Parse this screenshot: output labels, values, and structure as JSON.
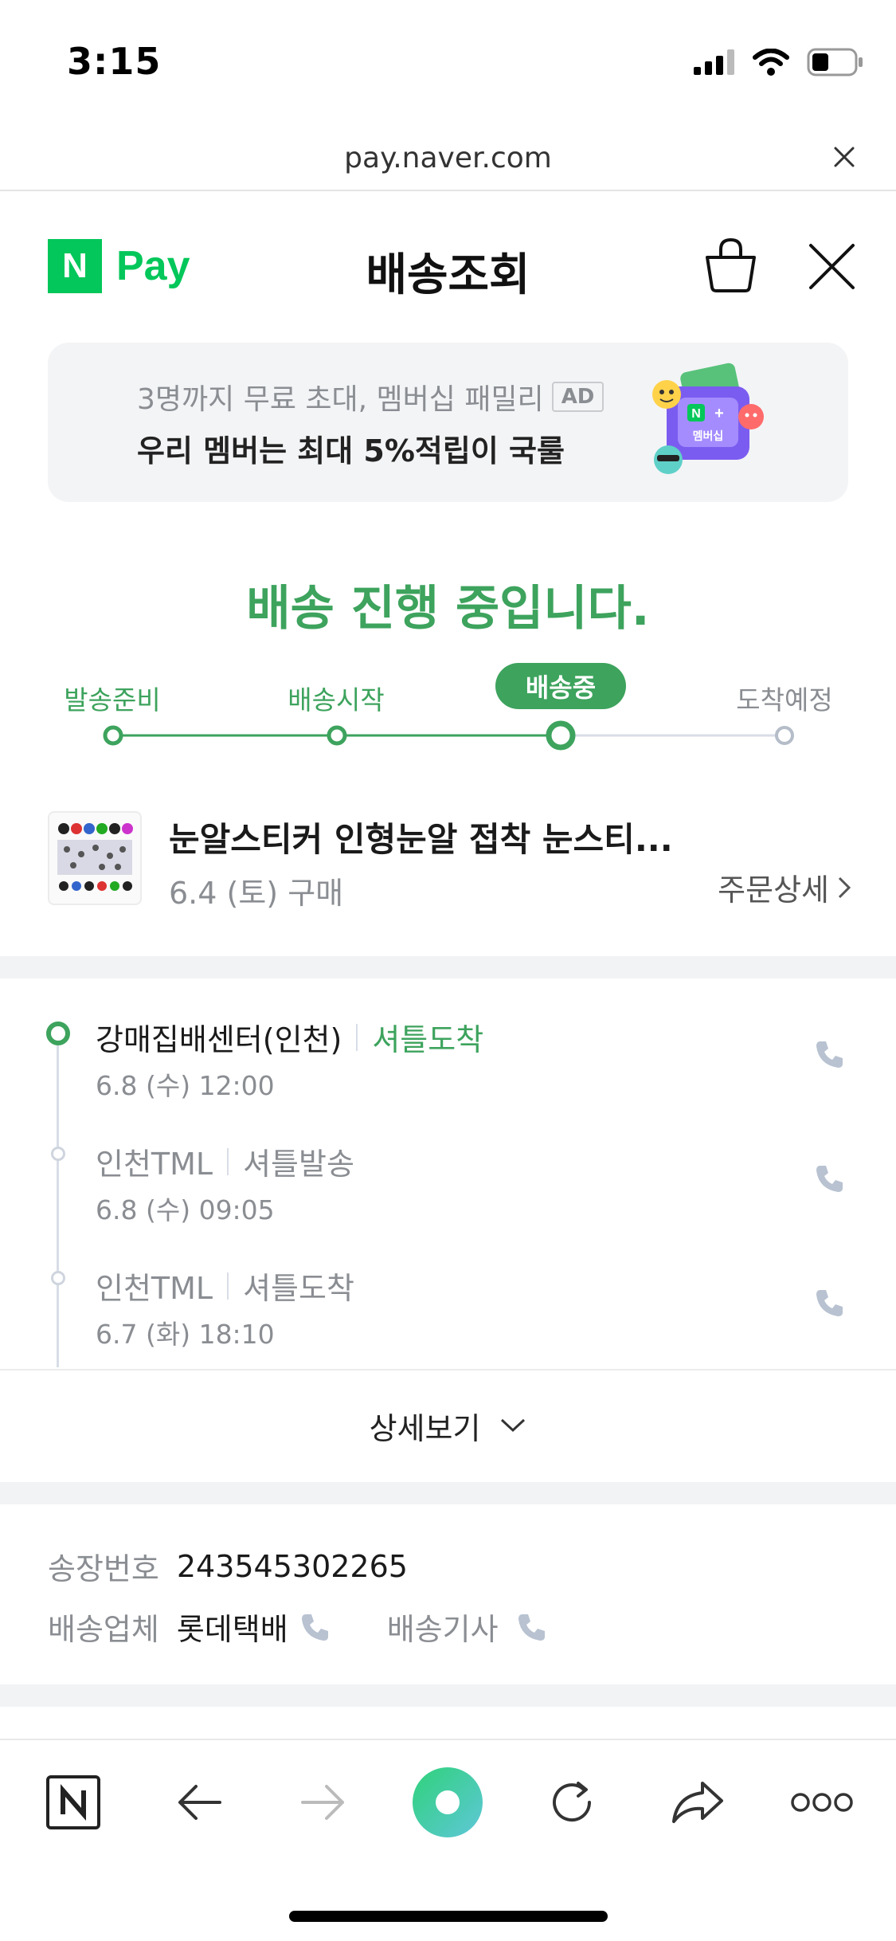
{
  "status_bar": {
    "time": "3:15"
  },
  "browser": {
    "url": "pay.naver.com"
  },
  "header": {
    "logo_n": "N",
    "logo_text": "Pay",
    "title": "배송조회"
  },
  "ad": {
    "line1": "3명까지 무료 초대, 멤버십 패밀리",
    "badge": "AD",
    "line2": "우리 멤버는 최대 5%적립이 국룰",
    "art_text": "멤버십"
  },
  "delivery": {
    "status_message": "배송 진행 중입니다.",
    "steps": [
      "발송준비",
      "배송시작",
      "배송중",
      "도착예정"
    ],
    "current_step": 3
  },
  "product": {
    "name": "눈알스티커 인형눈알 접착 눈스티...",
    "purchase_date": "6.4 (토) 구매",
    "order_detail_label": "주문상세"
  },
  "timeline": [
    {
      "place": "강매집배센터(인천)",
      "status": "셔틀도착",
      "time": "6.8 (수) 12:00"
    },
    {
      "place": "인천TML",
      "status": "셔틀발송",
      "time": "6.8 (수) 09:05"
    },
    {
      "place": "인천TML",
      "status": "셔틀도착",
      "time": "6.7 (화) 18:10"
    }
  ],
  "more_label": "상세보기",
  "invoice": {
    "number_label": "송장번호",
    "number": "243545302265",
    "carrier_label": "배송업체",
    "carrier": "롯데택배",
    "driver_label": "배송기사"
  },
  "colors": {
    "accent": "#3da35d",
    "brand": "#03c75a"
  }
}
